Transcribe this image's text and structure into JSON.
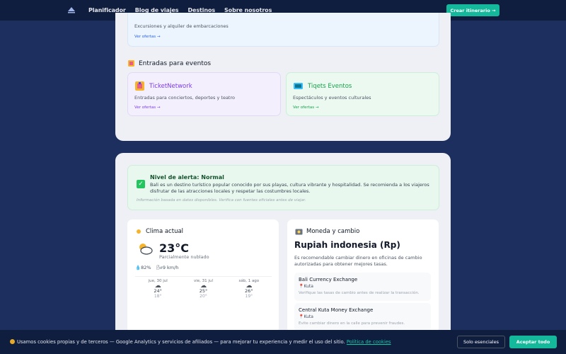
{
  "nav": {
    "logo": "logo",
    "links": [
      "Planificador",
      "Blog de viajes",
      "Destinos",
      "Sobre nosotros"
    ],
    "cta": "Crear itinerario →"
  },
  "boats": {
    "description": "Excursiones y alquiler de embarcaciones",
    "link": "Ver ofertas →"
  },
  "events": {
    "title": "Entradas para eventos",
    "icon": "ticket-icon",
    "items": [
      {
        "name": "TicketNetwork",
        "description": "Entradas para conciertos, deportes y teatro",
        "link": "Ver ofertas →",
        "icon": "ticket-icon",
        "color": "#7c3aed"
      },
      {
        "name": "Tiqets Eventos",
        "description": "Espectáculos y eventos culturales",
        "link": "Ver ofertas →",
        "icon": "ticket-box-icon",
        "color": "#16a34a"
      }
    ]
  },
  "alert": {
    "title": "Nivel de alerta: Normal",
    "body": "Bali es un destino turístico popular conocido por sus playas, cultura vibrante y hospitalidad. Se recomienda a los viajeros disfrutar de las atracciones locales y respetar las costumbres locales.",
    "note": "Información basada en datos disponibles. Verifica con fuentes oficiales antes de viajar."
  },
  "weather": {
    "title": "Clima actual",
    "temp": "23°C",
    "condition": "Parcialmente nublado",
    "humidity": "82%",
    "wind": "9 km/h",
    "forecast": [
      {
        "day": "jue, 30 jul",
        "hi": "24°",
        "lo": "18°"
      },
      {
        "day": "vie, 31 jul",
        "hi": "25°",
        "lo": "20°"
      },
      {
        "day": "sáb, 1 ago",
        "hi": "26°",
        "lo": "19°"
      }
    ]
  },
  "money": {
    "title": "Moneda y cambio",
    "currency": "Rupiah indonesia (Rp)",
    "note": "Es recomendable cambiar dinero en oficinas de cambio autorizadas para obtener mejores tasas.",
    "exchanges": [
      {
        "name": "Bali Currency Exchange",
        "location": "Kuta",
        "tip": "Verifique las tasas de cambio antes de realizar la transacción."
      },
      {
        "name": "Central Kuta Money Exchange",
        "location": "Kuta",
        "tip": "Evite cambiar dinero en la calle para prevenir fraudes."
      }
    ]
  },
  "cookies": {
    "text": "Usamos cookies propias y de terceros — Google Analytics y servicios de afiliados — para mejorar tu experiencia y medir el uso del sitio.",
    "policy": "Política de cookies",
    "essential": "Solo esenciales",
    "accept": "Aceptar todo"
  }
}
